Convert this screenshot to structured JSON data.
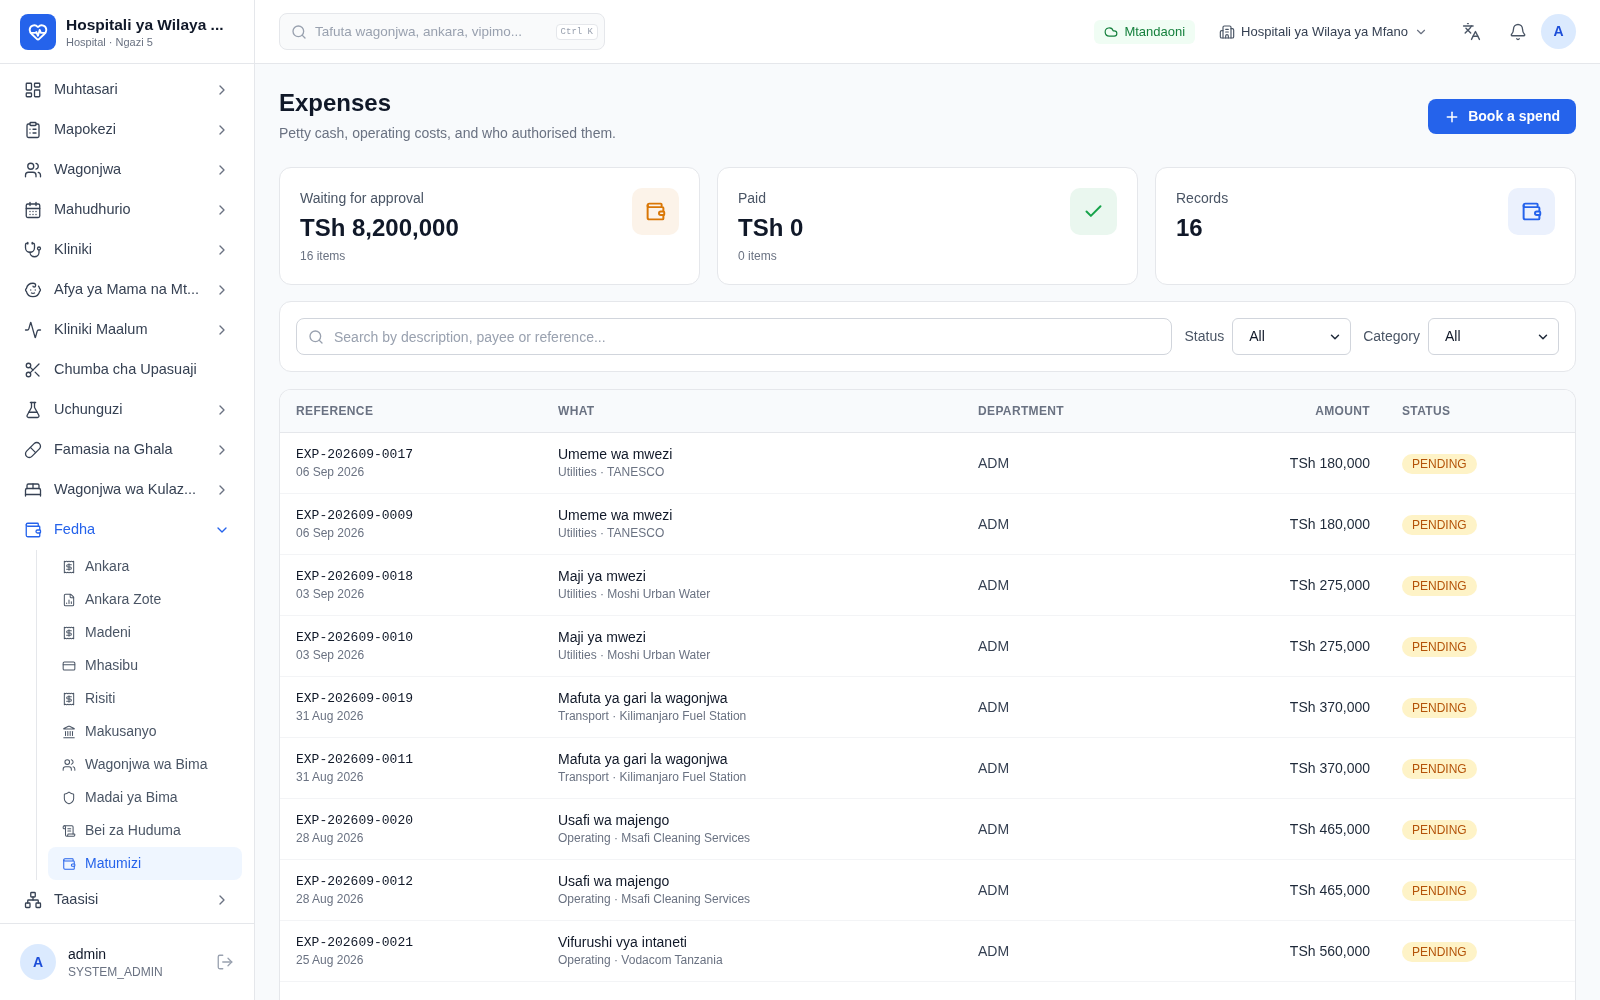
{
  "sidebar": {
    "brand": {
      "title": "Hospitali ya Wilaya ...",
      "subtitle": "Hospital · Ngazi 5"
    },
    "items": [
      {
        "label": "Muhtasari",
        "kind": "group",
        "expanded": false
      },
      {
        "label": "Mapokezi",
        "kind": "group",
        "expanded": false
      },
      {
        "label": "Wagonjwa",
        "kind": "group",
        "expanded": false
      },
      {
        "label": "Mahudhurio",
        "kind": "group",
        "expanded": false
      },
      {
        "label": "Kliniki",
        "kind": "group",
        "expanded": false
      },
      {
        "label": "Afya ya Mama na Mt...",
        "kind": "group",
        "expanded": false
      },
      {
        "label": "Kliniki Maalum",
        "kind": "group",
        "expanded": false
      },
      {
        "label": "Chumba cha Upasuaji",
        "kind": "link"
      },
      {
        "label": "Uchunguzi",
        "kind": "group",
        "expanded": false
      },
      {
        "label": "Famasia na Ghala",
        "kind": "group",
        "expanded": false
      },
      {
        "label": "Wagonjwa wa Kulaz...",
        "kind": "group",
        "expanded": false
      },
      {
        "label": "Fedha",
        "kind": "group",
        "expanded": true,
        "children": [
          {
            "label": "Ankara",
            "selected": false
          },
          {
            "label": "Ankara Zote",
            "selected": false
          },
          {
            "label": "Madeni",
            "selected": false
          },
          {
            "label": "Mhasibu",
            "selected": false
          },
          {
            "label": "Risiti",
            "selected": false
          },
          {
            "label": "Makusanyo",
            "selected": false
          },
          {
            "label": "Wagonjwa wa Bima",
            "selected": false
          },
          {
            "label": "Madai ya Bima",
            "selected": false
          },
          {
            "label": "Bei za Huduma",
            "selected": false
          },
          {
            "label": "Matumizi",
            "selected": true
          }
        ]
      },
      {
        "label": "Taasisi",
        "kind": "group",
        "expanded": false
      }
    ],
    "user": {
      "avatar": "A",
      "name": "admin",
      "role": "SYSTEM_ADMIN"
    }
  },
  "topbar": {
    "search": {
      "placeholder": "Tafuta wagonjwa, ankara, vipimo...",
      "shortcut": "Ctrl K"
    },
    "connection": "Mtandaoni",
    "facility": "Hospitali ya Wilaya ya Mfano",
    "avatar": "A"
  },
  "page": {
    "title": "Expenses",
    "subtitle": "Petty cash, operating costs, and who authorised them.",
    "action": "Book a spend"
  },
  "stats": [
    {
      "label": "Waiting for approval",
      "value": "TSh 8,200,000",
      "note": "16 items",
      "color": "#d97706"
    },
    {
      "label": "Paid",
      "value": "TSh 0",
      "note": "0 items",
      "color": "#16a34a"
    },
    {
      "label": "Records",
      "value": "16",
      "color": "#2563eb"
    }
  ],
  "filters": {
    "search": {
      "placeholder": "Search by description, payee or reference..."
    },
    "selects": [
      {
        "label": "Status",
        "value": "All"
      },
      {
        "label": "Category",
        "value": "All"
      }
    ]
  },
  "table": {
    "columns": [
      "REFERENCE",
      "WHAT",
      "DEPARTMENT",
      "AMOUNT",
      "STATUS"
    ],
    "rows": [
      {
        "reference": "EXP-202609-0017",
        "date": "06 Sep 2026",
        "what": "Umeme wa mwezi",
        "detail": "Utilities · TANESCO",
        "department": "ADM",
        "amount": "TSh 180,000",
        "status": "PENDING"
      },
      {
        "reference": "EXP-202609-0009",
        "date": "06 Sep 2026",
        "what": "Umeme wa mwezi",
        "detail": "Utilities · TANESCO",
        "department": "ADM",
        "amount": "TSh 180,000",
        "status": "PENDING"
      },
      {
        "reference": "EXP-202609-0018",
        "date": "03 Sep 2026",
        "what": "Maji ya mwezi",
        "detail": "Utilities · Moshi Urban Water",
        "department": "ADM",
        "amount": "TSh 275,000",
        "status": "PENDING"
      },
      {
        "reference": "EXP-202609-0010",
        "date": "03 Sep 2026",
        "what": "Maji ya mwezi",
        "detail": "Utilities · Moshi Urban Water",
        "department": "ADM",
        "amount": "TSh 275,000",
        "status": "PENDING"
      },
      {
        "reference": "EXP-202609-0019",
        "date": "31 Aug 2026",
        "what": "Mafuta ya gari la wagonjwa",
        "detail": "Transport · Kilimanjaro Fuel Station",
        "department": "ADM",
        "amount": "TSh 370,000",
        "status": "PENDING"
      },
      {
        "reference": "EXP-202609-0011",
        "date": "31 Aug 2026",
        "what": "Mafuta ya gari la wagonjwa",
        "detail": "Transport · Kilimanjaro Fuel Station",
        "department": "ADM",
        "amount": "TSh 370,000",
        "status": "PENDING"
      },
      {
        "reference": "EXP-202609-0020",
        "date": "28 Aug 2026",
        "what": "Usafi wa majengo",
        "detail": "Operating · Msafi Cleaning Services",
        "department": "ADM",
        "amount": "TSh 465,000",
        "status": "PENDING"
      },
      {
        "reference": "EXP-202609-0012",
        "date": "28 Aug 2026",
        "what": "Usafi wa majengo",
        "detail": "Operating · Msafi Cleaning Services",
        "department": "ADM",
        "amount": "TSh 465,000",
        "status": "PENDING"
      },
      {
        "reference": "EXP-202609-0021",
        "date": "25 Aug 2026",
        "what": "Vifurushi vya intaneti",
        "detail": "Operating · Vodacom Tanzania",
        "department": "ADM",
        "amount": "TSh 560,000",
        "status": "PENDING"
      }
    ]
  }
}
